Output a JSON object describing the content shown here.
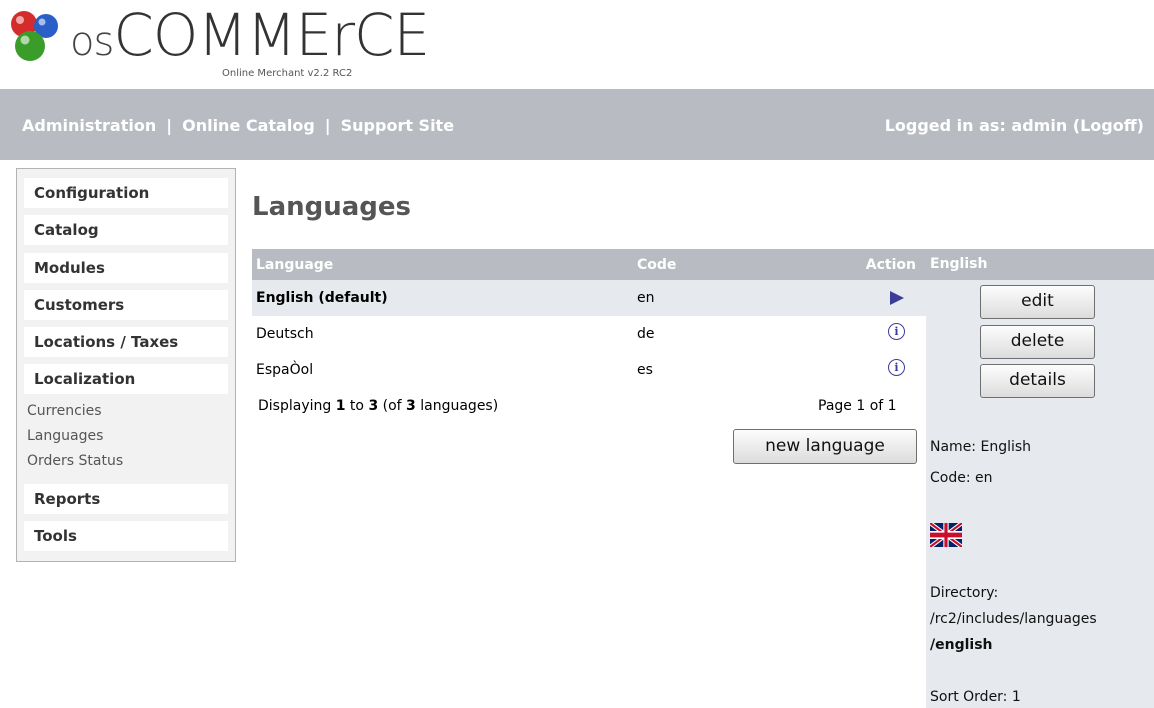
{
  "logo": {
    "prefix": "os",
    "name": "COMMErCE",
    "subtitle": "Online Merchant v2.2 RC2"
  },
  "topbar": {
    "links": [
      "Administration",
      "Online Catalog",
      "Support Site"
    ],
    "separator": "|",
    "login_text": "Logged in as: admin (Logoff)"
  },
  "sidebar": {
    "sections": [
      "Configuration",
      "Catalog",
      "Modules",
      "Customers",
      "Locations / Taxes",
      "Localization",
      "Reports",
      "Tools"
    ],
    "localization_items": [
      "Currencies",
      "Languages",
      "Orders Status"
    ]
  },
  "main": {
    "title": "Languages",
    "columns": {
      "language": "Language",
      "code": "Code",
      "action": "Action"
    },
    "rows": [
      {
        "language": "English (default)",
        "code": "en",
        "action_icon": "arrow-right-icon"
      },
      {
        "language": "Deutsch",
        "code": "de",
        "action_icon": "info-icon"
      },
      {
        "language": "EspaÒol",
        "code": "es",
        "action_icon": "info-icon"
      }
    ],
    "info_glyph": "i",
    "display": {
      "prefix": "Displaying ",
      "from": "1",
      "to_word": " to ",
      "to": "3",
      "of_prefix": " (of ",
      "total": "3",
      "suffix": " languages)"
    },
    "page_info": "Page 1 of 1",
    "new_language_button": "new language"
  },
  "info_panel": {
    "heading": "English",
    "buttons": [
      "edit",
      "delete",
      "details"
    ],
    "name": "Name: English",
    "code": "Code: en",
    "flag_icon": "uk-flag-icon",
    "directory_label": "Directory:",
    "directory_path": "/rc2/includes/languages",
    "directory_name": "/english",
    "sort_order": "Sort Order: 1"
  },
  "colors": {
    "topbar": "#b8bcc2",
    "selected_row": "#e6e9ed",
    "action_icon": "#3d3d99"
  }
}
